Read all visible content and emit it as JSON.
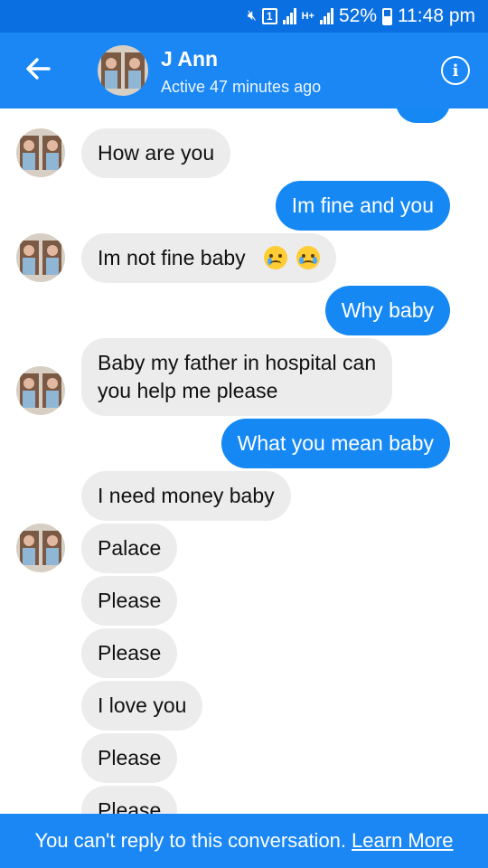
{
  "status_bar": {
    "battery": "52%",
    "time": "11:48 pm",
    "sim_badge": "1",
    "network": "H+"
  },
  "header": {
    "contact_name": "J Ann",
    "presence": "Active 47 minutes ago"
  },
  "messages": [
    {
      "dir": "in",
      "text": "How are you"
    },
    {
      "dir": "out",
      "text": "Im fine and you"
    },
    {
      "dir": "in",
      "text": "Im not fine baby"
    },
    {
      "dir": "out",
      "text": "Why baby"
    },
    {
      "dir": "in",
      "text": "Baby my father in hospital can you help me please"
    },
    {
      "dir": "out",
      "text": "What you mean baby"
    },
    {
      "dir": "in",
      "text": "I need money baby"
    },
    {
      "dir": "in",
      "text": "Palace"
    },
    {
      "dir": "in",
      "text": "Please"
    },
    {
      "dir": "in",
      "text": "Please"
    },
    {
      "dir": "in",
      "text": "I love you"
    },
    {
      "dir": "in",
      "text": "Please"
    },
    {
      "dir": "in",
      "text": "Please"
    }
  ],
  "message_lines": {
    "hospital_line1": "Baby my father in hospital can",
    "hospital_line2": "you help me please"
  },
  "footer": {
    "notice": "You can't reply to this conversation.",
    "link": "Learn More"
  },
  "colors": {
    "header": "#1a87f4",
    "status_bar": "#0a6fe0",
    "outgoing_bubble": "#1588f4",
    "incoming_bubble": "#ececec"
  }
}
